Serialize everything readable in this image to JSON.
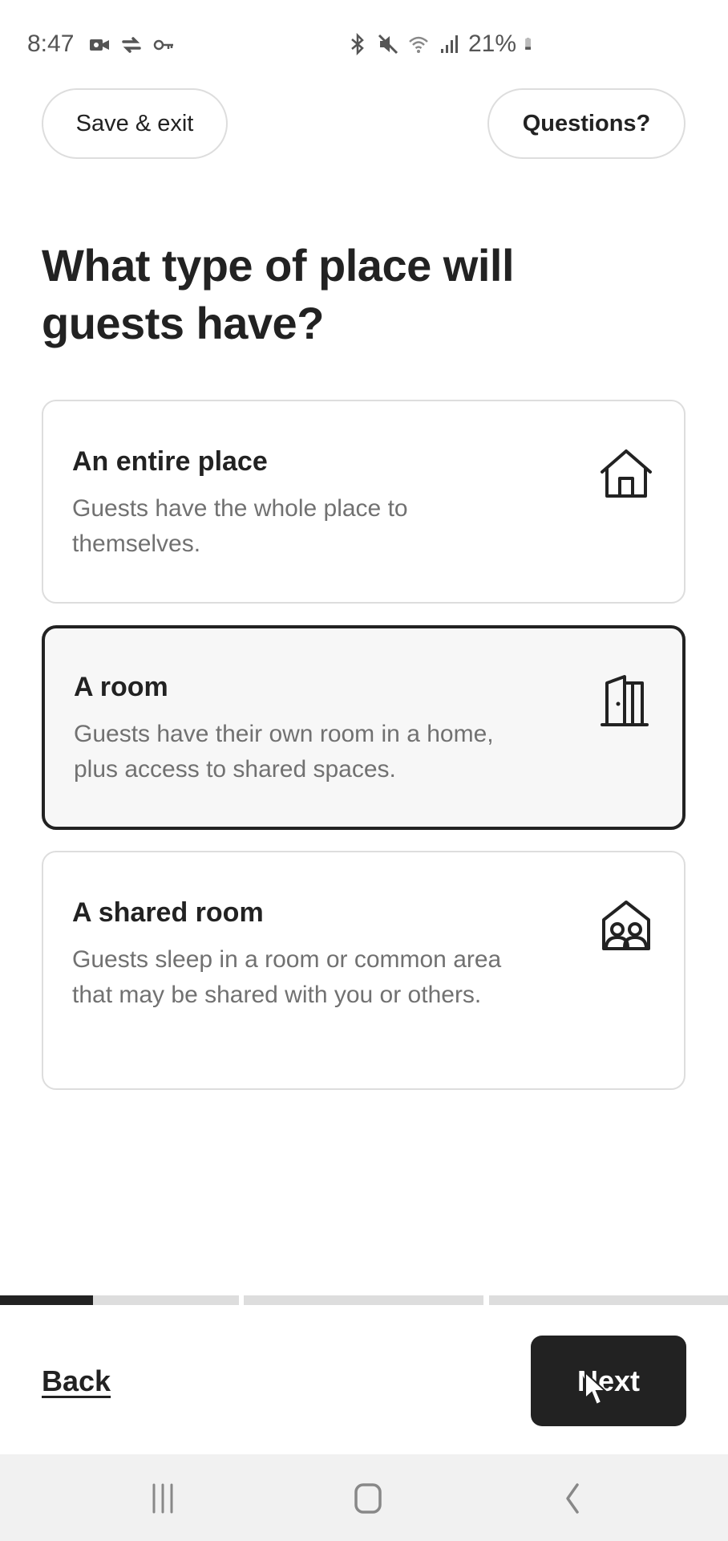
{
  "status_bar": {
    "time": "8:47",
    "left_icons": [
      "video-icon",
      "sync-icon",
      "key-icon"
    ],
    "right_icons": [
      "bluetooth-icon",
      "mute-icon",
      "wifi-icon",
      "signal-icon"
    ],
    "battery_percent": "21%"
  },
  "header": {
    "save_exit_label": "Save & exit",
    "questions_label": "Questions?"
  },
  "page": {
    "title": "What type of place will guests have?"
  },
  "options": [
    {
      "title": "An entire place",
      "description": "Guests have the whole place to themselves.",
      "icon": "house-icon",
      "selected": false
    },
    {
      "title": "A room",
      "description": "Guests have their own room in a home, plus access to shared spaces.",
      "icon": "door-icon",
      "selected": true
    },
    {
      "title": "A shared room",
      "description": "Guests sleep in a room or common area that may be shared with you or others.",
      "icon": "shared-room-icon",
      "selected": false
    }
  ],
  "progress": {
    "steps": 3,
    "current_step": 1,
    "current_step_fill": 0.39
  },
  "footer": {
    "back_label": "Back",
    "next_label": "Next"
  },
  "nav_bar": {
    "buttons": [
      "recent-apps-icon",
      "home-icon",
      "back-icon"
    ]
  },
  "colors": {
    "primary": "#222222",
    "border": "#dddddd",
    "muted_text": "#717171",
    "selected_bg": "#f7f7f7"
  }
}
